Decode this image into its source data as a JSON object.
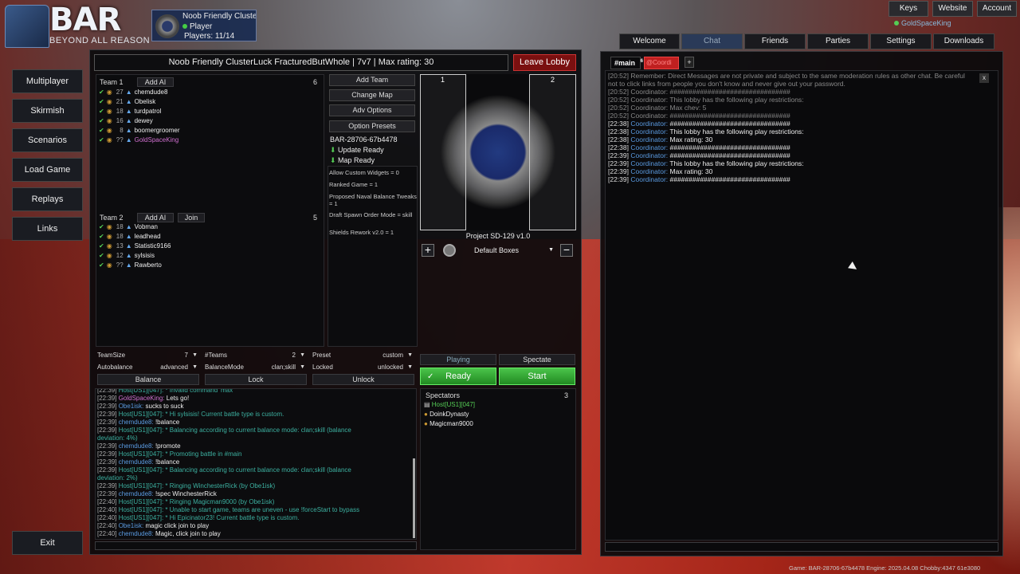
{
  "app": {
    "logo_text": "BAR",
    "logo_sub": "BEYOND ALL REASON"
  },
  "lobby_card": {
    "title": "Noob Friendly Cluster",
    "role": "Player",
    "players": "Players: 11/14"
  },
  "top_nav": {
    "keys": "Keys",
    "website": "Website",
    "account": "Account",
    "username": "GoldSpaceKing"
  },
  "left_nav": {
    "items": [
      "Multiplayer",
      "Skirmish",
      "Scenarios",
      "Load Game",
      "Replays",
      "Links"
    ],
    "exit": "Exit"
  },
  "battle": {
    "title": "Noob Friendly ClusterLuck FracturedButWhole | 7v7 | Max rating: 30",
    "leave": "Leave Lobby"
  },
  "team1": {
    "label": "Team 1",
    "add_ai": "Add AI",
    "count": "6",
    "players": [
      {
        "lv": "27",
        "name": "chemdude8"
      },
      {
        "lv": "21",
        "name": "Obelisk"
      },
      {
        "lv": "18",
        "name": "turdpatrol"
      },
      {
        "lv": "16",
        "name": "dewey"
      },
      {
        "lv": "8",
        "name": "boomergroomer"
      },
      {
        "lv": "??",
        "name": "GoldSpaceKing"
      }
    ]
  },
  "team2": {
    "label": "Team 2",
    "add_ai": "Add AI",
    "join": "Join",
    "count": "5",
    "players": [
      {
        "lv": "18",
        "name": "Vobman"
      },
      {
        "lv": "18",
        "name": "leadhead"
      },
      {
        "lv": "13",
        "name": "Statistic9166"
      },
      {
        "lv": "12",
        "name": "sylsisis"
      },
      {
        "lv": "??",
        "name": "Rawberto"
      }
    ]
  },
  "actions": {
    "add_team": "Add Team",
    "change_map": "Change Map",
    "adv_options": "Adv Options",
    "option_presets": "Option Presets",
    "engine": "BAR-28706-67b4478",
    "update_ready": "Update Ready",
    "map_ready": "Map Ready"
  },
  "options": [
    "Allow Custom Widgets = 0",
    "Ranked Game = 1",
    "Proposed Naval Balance Tweaks = 1",
    "Draft Spawn Order Mode = skill",
    "Shields Rework v2.0 = 1"
  ],
  "map": {
    "name": "Project SD-129 v1.0",
    "box1": "1",
    "box2": "2",
    "start_boxes": "Default Boxes"
  },
  "settings": {
    "teamsize_label": "TeamSize",
    "teamsize": "7",
    "teams_label": "#Teams",
    "teams": "2",
    "preset_label": "Preset",
    "preset": "custom",
    "autobalance_label": "Autobalance",
    "autobalance": "advanced",
    "balancemode_label": "BalanceMode",
    "balancemode": "clan;skill",
    "locked_label": "Locked",
    "locked": "unlocked",
    "balance": "Balance",
    "lock": "Lock",
    "unlock": "Unlock"
  },
  "play": {
    "playing": "Playing",
    "spectate": "Spectate",
    "ready": "Ready",
    "start": "Start"
  },
  "spectators": {
    "label": "Spectators",
    "count": "3",
    "list": [
      "Host[US1][047]",
      "DoinkDynasty",
      "Magicman9000"
    ]
  },
  "chat": [
    {
      "t": "[22:39]",
      "n": "Host[US1][047]:",
      "m": " * Invalid command 'max'",
      "k": "host"
    },
    {
      "t": "[22:39]",
      "n": "GoldSpaceKing:",
      "m": " Lets go!",
      "k": "gold"
    },
    {
      "t": "[22:39]",
      "n": "Obe1isk:",
      "m": " sucks to suck",
      "k": "user"
    },
    {
      "t": "[22:39]",
      "n": "Host[US1][047]:",
      "m": " * Hi sylsisis! Current battle type is custom.",
      "k": "host"
    },
    {
      "t": "[22:39]",
      "n": "chemdude8:",
      "m": " !balance",
      "k": "user"
    },
    {
      "t": "[22:39]",
      "n": "Host[US1][047]:",
      "m": " * Balancing according to current balance mode: clan;skill (balance",
      "k": "host"
    },
    {
      "t": "",
      "n": "",
      "m": "deviation: 4%)",
      "k": "host"
    },
    {
      "t": "[22:39]",
      "n": "chemdude8:",
      "m": " !promote",
      "k": "user"
    },
    {
      "t": "[22:39]",
      "n": "Host[US1][047]:",
      "m": " * Promoting battle in #main",
      "k": "host"
    },
    {
      "t": "[22:39]",
      "n": "chemdude8:",
      "m": " !balance",
      "k": "user"
    },
    {
      "t": "[22:39]",
      "n": "Host[US1][047]:",
      "m": " * Balancing according to current balance mode: clan;skill (balance",
      "k": "host"
    },
    {
      "t": "",
      "n": "",
      "m": "deviation: 2%)",
      "k": "host"
    },
    {
      "t": "[22:39]",
      "n": "Host[US1][047]:",
      "m": " * Ringing WinchesterRick (by Obe1isk)",
      "k": "host"
    },
    {
      "t": "[22:39]",
      "n": "chemdude8:",
      "m": " !spec WinchesterRick",
      "k": "user"
    },
    {
      "t": "[22:40]",
      "n": "Host[US1][047]:",
      "m": " * Ringing Magicman9000 (by Obe1isk)",
      "k": "host"
    },
    {
      "t": "[22:40]",
      "n": "Host[US1][047]:",
      "m": " * Unable to start game, teams are uneven - use !forceStart to bypass",
      "k": "host"
    },
    {
      "t": "[22:40]",
      "n": "Host[US1][047]:",
      "m": " * Hi Epicinator23! Current battle type is custom.",
      "k": "host"
    },
    {
      "t": "[22:40]",
      "n": "Obe1isk:",
      "m": " magic click join to play",
      "k": "user"
    },
    {
      "t": "[22:40]",
      "n": "chemdude8:",
      "m": " Magic, click join to play",
      "k": "user"
    }
  ],
  "right": {
    "tabs": [
      "Welcome",
      "Chat",
      "Friends",
      "Parties",
      "Settings",
      "Downloads"
    ],
    "channel": "#main",
    "channel_badge": "6",
    "channel2": "@Coordi",
    "add": "+",
    "close": "x",
    "notice": [
      "[20:52] Remember: Direct Messages are not private and subject to the same moderation rules as other chat. Be careful",
      "not to click links from people you don't know and never give out your password."
    ],
    "lines": [
      {
        "t": "[20:52]",
        "n": "Coordinator:",
        "m": " ################################",
        "g": true
      },
      {
        "t": "[20:52]",
        "n": "Coordinator:",
        "m": " This lobby has the following play restrictions:",
        "g": true
      },
      {
        "t": "[20:52]",
        "n": "Coordinator:",
        "m": " Max chev: 5",
        "g": true
      },
      {
        "t": "[20:52]",
        "n": "Coordinator:",
        "m": " ################################",
        "g": true
      },
      {
        "t": "[22:38]",
        "n": "Coordinator:",
        "m": " ################################",
        "g": false
      },
      {
        "t": "[22:38]",
        "n": "Coordinator:",
        "m": " This lobby has the following play restrictions:",
        "g": false
      },
      {
        "t": "[22:38]",
        "n": "Coordinator:",
        "m": " Max rating: 30",
        "g": false
      },
      {
        "t": "[22:38]",
        "n": "Coordinator:",
        "m": " ################################",
        "g": false
      },
      {
        "t": "[22:39]",
        "n": "Coordinator:",
        "m": " ################################",
        "g": false
      },
      {
        "t": "[22:39]",
        "n": "Coordinator:",
        "m": " This lobby has the following play restrictions:",
        "g": false
      },
      {
        "t": "[22:39]",
        "n": "Coordinator:",
        "m": " Max rating: 30",
        "g": false
      },
      {
        "t": "[22:39]",
        "n": "Coordinator:",
        "m": " ################################",
        "g": false
      }
    ]
  },
  "footer": "Game: BAR-28706-67b4478  Engine: 2025.04.08  Chobby:4347 61e3080"
}
